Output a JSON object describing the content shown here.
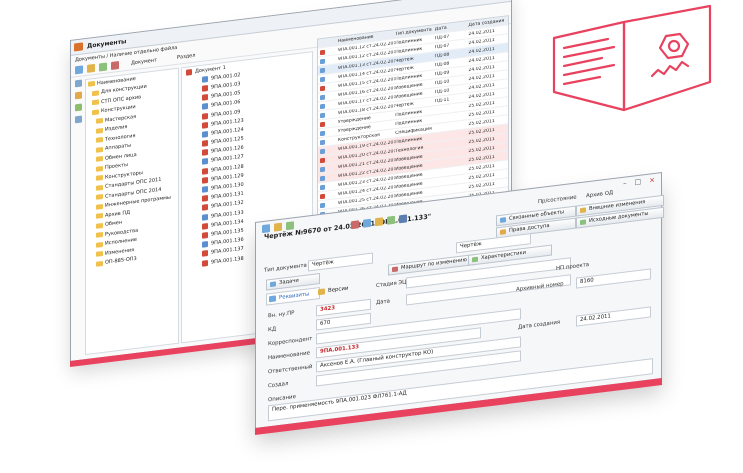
{
  "back": {
    "title": "Документы",
    "subtitle": "Документы / Наличие отдельно файла",
    "label_doc": "Документ",
    "label_type": "Раздел",
    "tree": [
      "Наименование",
      "Для конструкции",
      "СТП ОПС архив",
      "Конструкции",
      "Мастерская",
      "Изделия",
      "Технология",
      "Аппараты",
      "Обмен лица",
      "Проекты",
      "Конструкторы",
      "Стандарты ОПС 2011",
      "Стандарты ОПС 2014",
      "Инженерные программы",
      "Архив ПД",
      "Обмен",
      "Руководства",
      "Исполнение",
      "Изменения",
      "ОП-885-ОП3"
    ],
    "mid": [
      "Документ 1",
      "9ПА.001.02",
      "9ПА.001.03",
      "9ПА.001.05",
      "9ПА.001.06",
      "9ПА.001.09",
      "9ПА.001.123",
      "9ПА.001.124",
      "9ПА.001.125",
      "9ПА.001.126",
      "9ПА.001.127",
      "9ПА.001.128",
      "9ПА.001.129",
      "9ПА.001.130",
      "9ПА.001.131",
      "9ПА.001.132",
      "9ПА.001.133",
      "9ПА.001.134",
      "9ПА.001.135",
      "9ПА.001.136",
      "9ПА.001.137",
      "9ПА.001.138"
    ],
    "grid_header": [
      "Наименование",
      "Тип документа",
      "Дата",
      "Дата создания"
    ],
    "grid": [
      [
        "9ПА.001.12 ст.24.02.2011",
        "Подлинник",
        "ПД-07",
        "24.02.2011"
      ],
      [
        "9ПА.001.12 ст.24.02.2011",
        "Подлинник",
        "ПД-07",
        "24.02.2011"
      ],
      [
        "9ПА.001.13 ст.24.02.2011",
        "Чертёж",
        "ПД-08",
        "24.02.2011"
      ],
      [
        "9ПА.001.14 ст.24.02.2011",
        "Чертёж",
        "ПД-08",
        "24.02.2011"
      ],
      [
        "9ПА.001.15 ст.24.02.2011",
        "Подлинник",
        "ПД-09",
        "24.02.2011"
      ],
      [
        "9ПА.001.16 ст.24.02.2011",
        "Извещение",
        "ПД-10",
        "24.02.2011"
      ],
      [
        "9ПА.001.17 ст.24.02.2011",
        "Извещение",
        "ПД-10",
        "24.02.2011"
      ],
      [
        "9ПА.001.18 ст.24.02.2011",
        "Чертёж",
        "ПД-11",
        "24.02.2011"
      ],
      [
        "Утверждение",
        "Подлинник",
        "",
        "25.02.2011"
      ],
      [
        "Утверждение",
        "Подлинник",
        "",
        "25.02.2011"
      ],
      [
        "Конструкторская",
        "Спецификация",
        "",
        "25.02.2011"
      ],
      [
        "9ПА.001.19 ст.24.02.2011",
        "Подлинник",
        "",
        "25.02.2011"
      ],
      [
        "9ПА.001.20 ст.24.02.2011",
        "Технология",
        "",
        "25.02.2011"
      ],
      [
        "9ПА.001.21 ст.24.02.2011",
        "Извещение",
        "",
        "25.02.2011"
      ],
      [
        "9ПА.001.22 ст.24.02.2011",
        "Извещение",
        "",
        "25.02.2011"
      ],
      [
        "9ПА.001.23 ст.24.02.2011",
        "Извещение",
        "",
        "25.02.2011"
      ],
      [
        "9ПА.001.24 ст.24.02.2011",
        "Извещение",
        "",
        "25.02.2011"
      ],
      [
        "9ПА.001.25 ст.24.02.2011",
        "Извещение",
        "",
        "25.02.2011"
      ],
      [
        "9ПА.001.26 ст.24.02.2011",
        "Извещение",
        "",
        "25.02.2011"
      ],
      [
        "9ПА.001.27 ст.24.02.2011",
        "Извещение",
        "",
        "25.02.2011"
      ]
    ]
  },
  "front": {
    "title": "Чертёж №9670 от 24.02.2011 \"9ПА.001.133\"",
    "doc_type_label": "Тип документа",
    "doc_type_value": "Чертёж",
    "tabs": [
      "Задачи",
      "Маршрут по изменению",
      "Характеристики",
      "Права доступа",
      "Связанные объекты",
      "Исходные документы",
      "Внешние изменения"
    ],
    "sub_tabs": [
      "Реквизиты",
      "Версии"
    ],
    "prostoyanie_label": "Пр/состояние",
    "prostoyanie_value": "Архив ОД",
    "stage_label": "Стадия ЭЦ",
    "vn_label": "Вн. ну.ПР",
    "vn_value": "3423",
    "kd_label": "КД",
    "kd_value": "670",
    "date_label": "Дата",
    "inv_label": "НП проекта",
    "archive_label": "Архивный номер",
    "archive_value": "8160",
    "korr_label": "Корреспондент",
    "name_label": "Наименование",
    "name_value": "9ПА.001.133",
    "created_label": "Дата создания",
    "created_value": "24.02.2011",
    "resp_label": "Ответственный",
    "resp_value": "Аксенов Е.А. (Главный конструктор КО)",
    "author_label": "Создал",
    "note_label": "Описание",
    "note_value": "Пере. применяемость 9ПА.001.023 ФЛ761.1-АД"
  },
  "colors": {
    "accent_red": "#e8425f",
    "doc_red": "#c0282c",
    "link_blue": "#2a6bbf"
  }
}
